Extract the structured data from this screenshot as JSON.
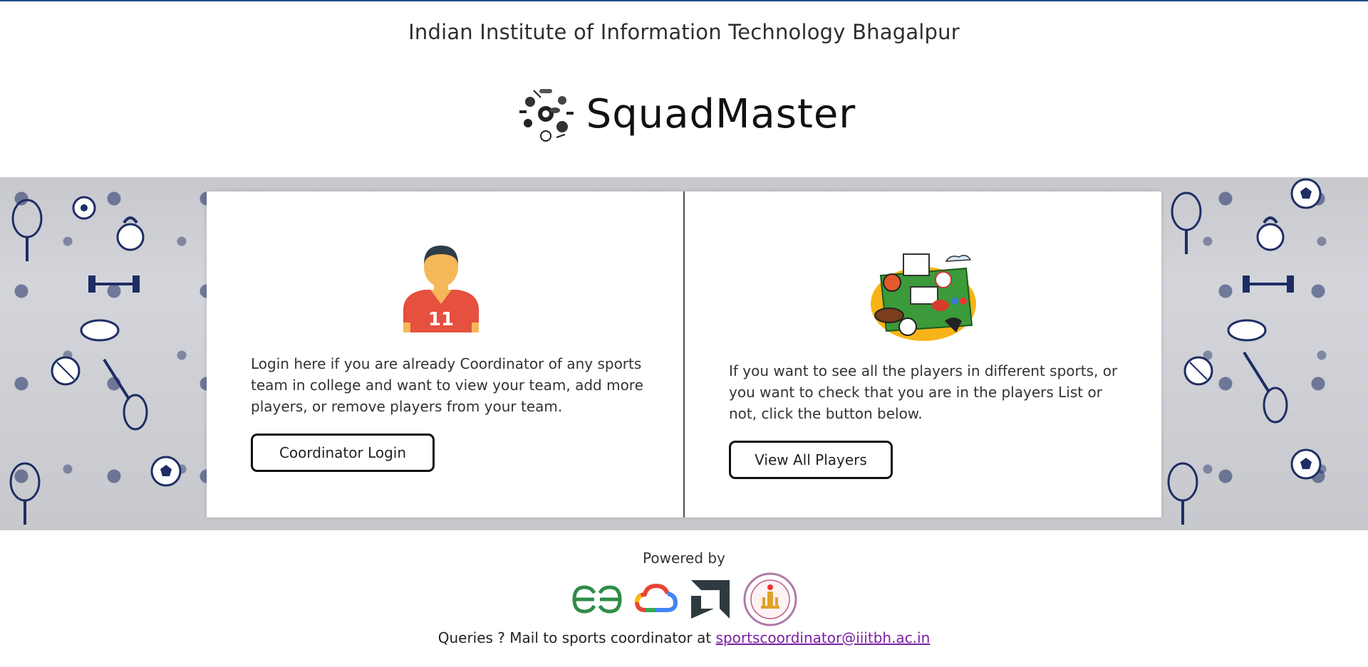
{
  "header": {
    "institute": "Indian Institute of Information Technology Bhagalpur",
    "app_name": "SquadMaster"
  },
  "cards": {
    "coordinator": {
      "text": "Login here if you are already Coordinator of any sports team in college and want to view your team, add more players, or remove players from your team.",
      "button": "Coordinator Login"
    },
    "players": {
      "text": "If you want to see all the players in different sports, or you want to check that you are in the players List or not, click the button below.",
      "button": "View All Players"
    }
  },
  "footer": {
    "powered_by": "Powered by",
    "query_prefix": "Queries ? Mail to sports coordinator at",
    "email": "sportscoordinator@iiitbh.ac.in"
  },
  "colors": {
    "accent_top": "#1f4f8f",
    "link": "#7a1fa2",
    "banner_bg": "#d3d5da"
  },
  "icons": [
    "sports-collage-logo",
    "footballer-avatar-icon",
    "sports-collage-icon",
    "gfg-logo",
    "google-cloud-logo",
    "amd-logo",
    "iiit-bhagalpur-seal"
  ]
}
